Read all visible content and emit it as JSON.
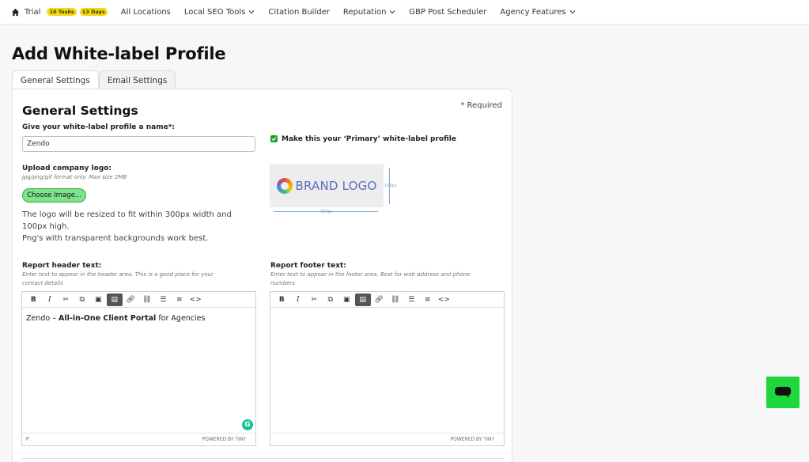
{
  "nav": {
    "trial_label": "Trial",
    "tasks_badge": "10 Tasks",
    "days_badge": "13 Days",
    "items": [
      "All Locations",
      "Local SEO Tools",
      "Citation Builder",
      "Reputation",
      "GBP Post Scheduler",
      "Agency Features"
    ]
  },
  "page": {
    "title": "Add White-label Profile"
  },
  "tabs": [
    "General Settings",
    "Email Settings"
  ],
  "form": {
    "heading": "General Settings",
    "required_note": "* Required",
    "name_label": "Give your white-label profile a name*:",
    "name_value": "Zendo",
    "primary_label": "Make this your ‘Primary’ white-label profile",
    "primary_checked": true,
    "logo_label": "Upload company logo:",
    "logo_hint": "jpg/png/gif format only. Max size 2MB",
    "choose_button": "Choose Image...",
    "resize_note_1": "The logo will be resized to fit within 300px width and 100px high.",
    "resize_note_2": "Png's with transparent backgrounds work best.",
    "logo_placeholder_text": "BRAND LOGO",
    "logo_width_label": "300px",
    "logo_height_label": "100px",
    "header_label": "Report header text:",
    "header_hint": "Enter text to appear in the header area. This is a good place for your contact details",
    "header_content_prefix": "Zendo – ",
    "header_content_bold": "All-in-One Client Portal",
    "header_content_suffix": " for Agencies",
    "header_path": "P",
    "footer_label": "Report footer text:",
    "footer_hint": "Enter text to appear in the footer area. Best for web address and phone numbers",
    "powered_by": "POWERED BY TINY"
  },
  "colors": {
    "accent_green": "#1fd63d",
    "button_green": "#7fe38a",
    "badge_yellow": "#f5d90a"
  }
}
